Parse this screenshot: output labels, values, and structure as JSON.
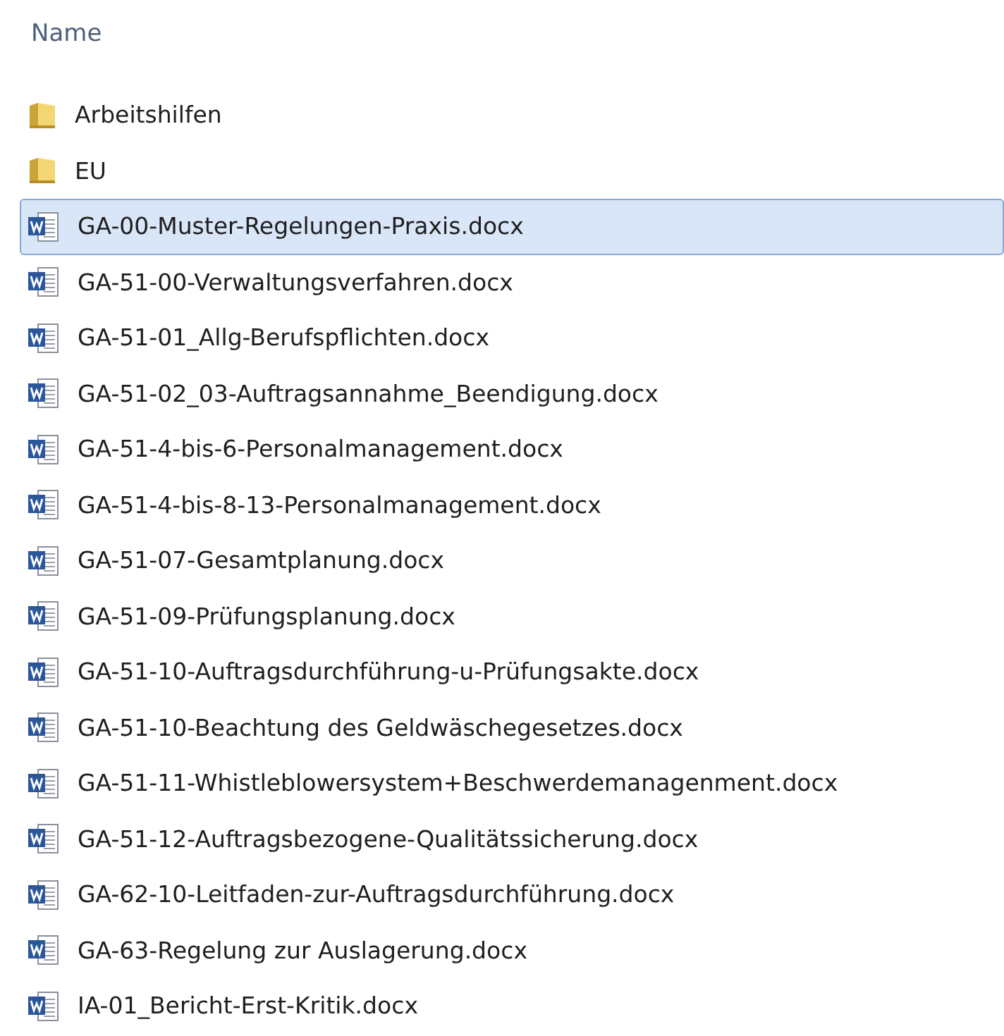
{
  "header": {
    "label": "Name"
  },
  "items": [
    {
      "kind": "folder",
      "name": "Arbeitshilfen",
      "selected": false
    },
    {
      "kind": "folder",
      "name": "EU",
      "selected": false
    },
    {
      "kind": "word",
      "name": "GA-00-Muster-Regelungen-Praxis.docx",
      "selected": true
    },
    {
      "kind": "word",
      "name": "GA-51-00-Verwaltungsverfahren.docx",
      "selected": false
    },
    {
      "kind": "word",
      "name": "GA-51-01_Allg-Berufspflichten.docx",
      "selected": false
    },
    {
      "kind": "word",
      "name": "GA-51-02_03-Auftragsannahme_Beendigung.docx",
      "selected": false
    },
    {
      "kind": "word",
      "name": "GA-51-4-bis-6-Personalmanagement.docx",
      "selected": false
    },
    {
      "kind": "word",
      "name": "GA-51-4-bis-8-13-Personalmanagement.docx",
      "selected": false
    },
    {
      "kind": "word",
      "name": "GA-51-07-Gesamtplanung.docx",
      "selected": false
    },
    {
      "kind": "word",
      "name": "GA-51-09-Prüfungsplanung.docx",
      "selected": false
    },
    {
      "kind": "word",
      "name": "GA-51-10-Auftragsdurchführung-u-Prüfungsakte.docx",
      "selected": false
    },
    {
      "kind": "word",
      "name": "GA-51-10-Beachtung des Geldwäschegesetzes.docx",
      "selected": false
    },
    {
      "kind": "word",
      "name": "GA-51-11-Whistleblowersystem+Beschwerdemanagenment.docx",
      "selected": false
    },
    {
      "kind": "word",
      "name": "GA-51-12-Auftragsbezogene-Qualitätssicherung.docx",
      "selected": false
    },
    {
      "kind": "word",
      "name": "GA-62-10-Leitfaden-zur-Auftragsdurchführung.docx",
      "selected": false
    },
    {
      "kind": "word",
      "name": "GA-63-Regelung zur Auslagerung.docx",
      "selected": false
    },
    {
      "kind": "word",
      "name": "IA-01_Bericht-Erst-Kritik.docx",
      "selected": false
    }
  ]
}
